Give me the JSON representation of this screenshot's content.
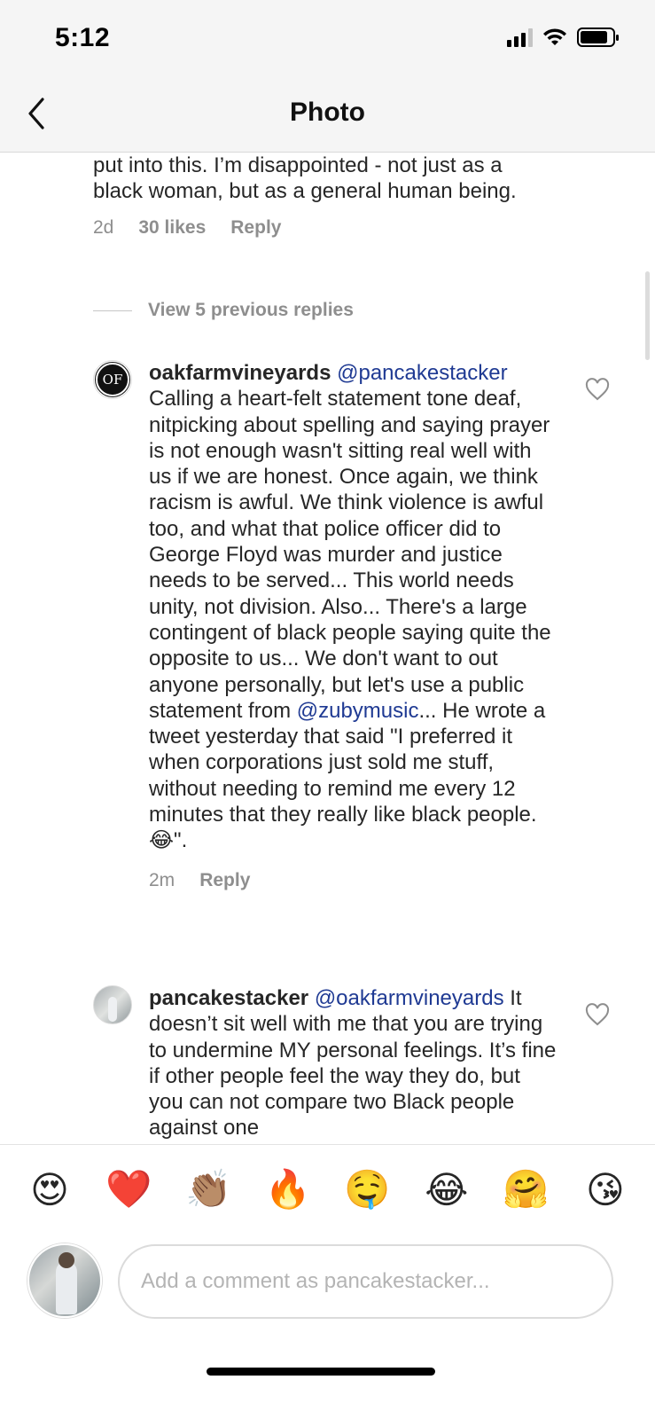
{
  "status": {
    "time": "5:12"
  },
  "nav": {
    "title": "Photo"
  },
  "previous_comment": {
    "text": "put into this. I’m disappointed - not just as a black woman, but as a general human being.",
    "age": "2d",
    "likes": "30 likes",
    "reply_label": "Reply"
  },
  "view_replies": {
    "label": "View 5 previous replies"
  },
  "comments": [
    {
      "username": "oakfarmvineyards",
      "mention": "@pancakestacker",
      "text_part1": "Calling a heart-felt statement tone deaf, nitpicking about spelling and saying prayer is not enough wasn't sitting real well with us if we are honest. Once again, we think racism is awful. We think violence is awful too, and what that police officer did to George Floyd was murder and justice needs to be served... This world needs unity, not division.  Also... There's a large contingent of black people saying quite the opposite to us... We don't want to out anyone personally, but let's use a public statement from ",
      "inline_mention": "@zubymusic",
      "text_part2": "... He wrote a tweet yesterday that said \"I preferred it when corporations just sold me stuff, without needing to remind me every 12 minutes that they really like black people. 😂\".",
      "avatar_initials": "OF",
      "age": "2m",
      "reply_label": "Reply"
    },
    {
      "username": "pancakestacker",
      "mention": "@oakfarmvineyards",
      "text": "It doesn’t sit well with me that you are trying to undermine MY personal feelings. It’s fine if other people feel the way they do, but you can not compare two Black people against one"
    }
  ],
  "emoji_bar": [
    "😍",
    "❤️",
    "👏🏽",
    "🔥",
    "🤤",
    "😂",
    "🤗",
    "😘"
  ],
  "composer": {
    "placeholder": "Add a comment as pancakestacker..."
  },
  "colors": {
    "mention": "#1f3a93",
    "meta": "#8e8e8e",
    "text": "#262626"
  },
  "icons": {
    "back": "chevron-left-icon",
    "like": "heart-outline-icon"
  }
}
